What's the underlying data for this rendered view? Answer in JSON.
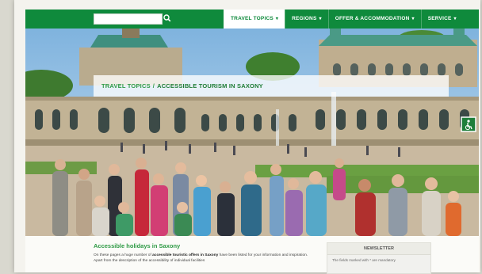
{
  "search": {
    "placeholder": ""
  },
  "nav": {
    "items": [
      {
        "label": "TRAVEL TOPICS",
        "active": true
      },
      {
        "label": "REGIONS",
        "active": false
      },
      {
        "label": "OFFER & ACCOMMODATION",
        "active": false
      },
      {
        "label": "SERVICE",
        "active": false
      }
    ]
  },
  "breadcrumb": {
    "parent": "TRAVEL TOPICS",
    "separator": "/",
    "current": "ACCESSIBLE TOURISM IN SAXONY"
  },
  "article": {
    "title": "Accessible holidays in Saxony",
    "intro_start": "On these pages a huge number of ",
    "intro_bold": "accessible touristic offers in Saxony",
    "intro_end": " have been listed for your information and inspiration. Apart from the description of the accessibility of individual facilities"
  },
  "newsletter": {
    "title": "NEWSLETTER",
    "text": "The fields marked with * are mandatory"
  },
  "colors": {
    "brand_green": "#0f8a3c",
    "title_green": "#2e9a45"
  },
  "icons": {
    "search": "search-icon",
    "chevron": "chevron-down-icon",
    "wheelchair": "wheelchair-icon"
  }
}
